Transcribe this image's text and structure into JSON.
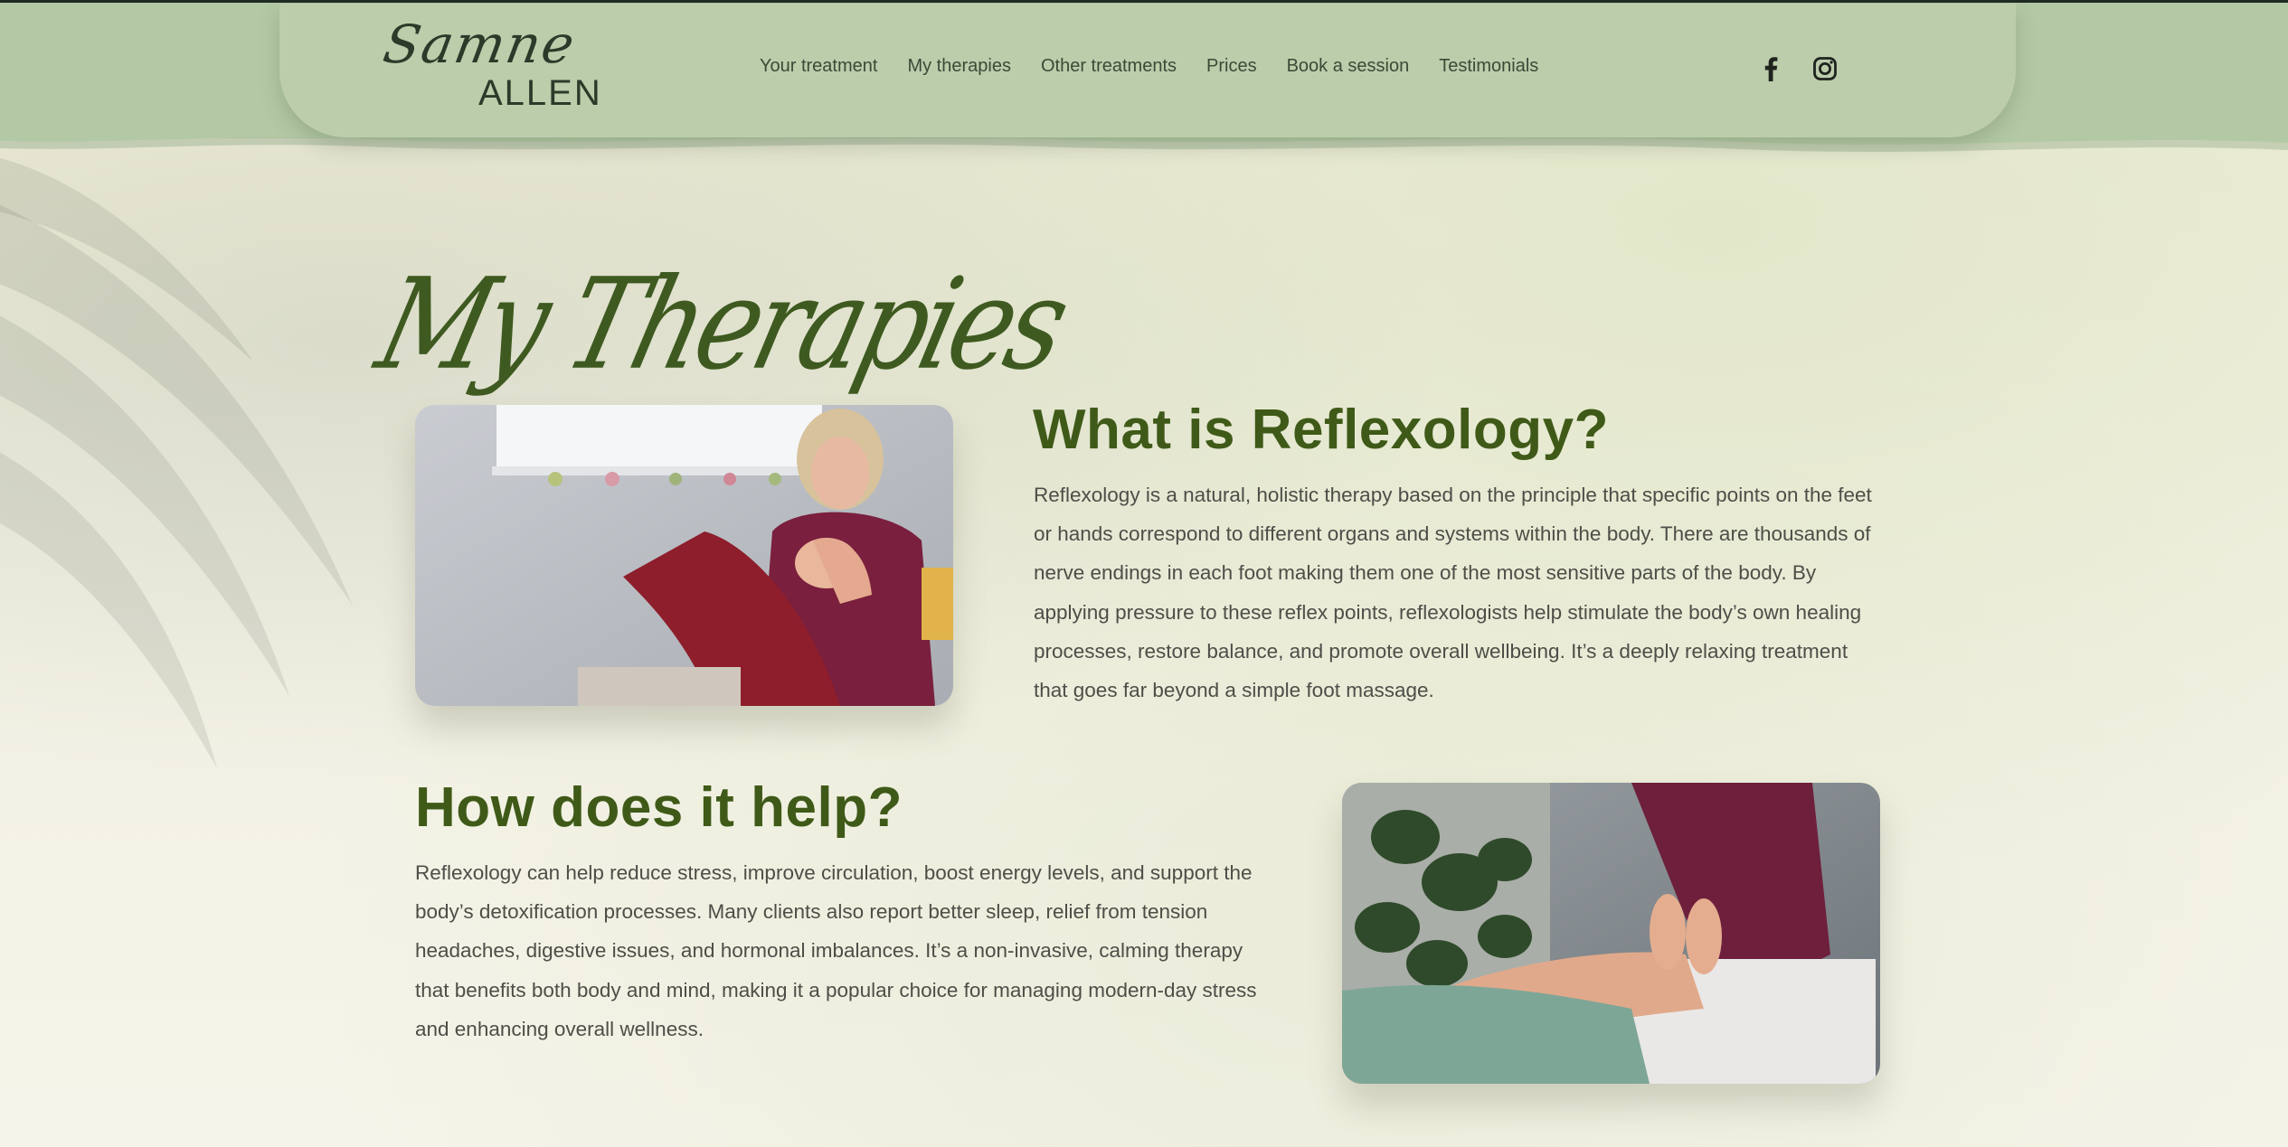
{
  "header": {
    "logo_script": "Samne",
    "logo_name": "ALLEN",
    "nav": [
      {
        "label": "Your treatment"
      },
      {
        "label": "My therapies"
      },
      {
        "label": "Other treatments"
      },
      {
        "label": "Prices"
      },
      {
        "label": "Book a session"
      },
      {
        "label": "Testimonials"
      }
    ],
    "social_icons": [
      "facebook-icon",
      "instagram-icon"
    ]
  },
  "page": {
    "heading": "My Therapies"
  },
  "sections": [
    {
      "title": "What is Reflexology?",
      "body": "Reflexology is a natural, holistic therapy based on the principle that specific points on the feet or hands correspond to different organs and systems within the body. There are thousands of nerve endings in each foot making them one of the most sensitive parts of the body. By applying pressure to these reflex points, reflexologists help stimulate the body’s own healing processes, restore balance, and promote overall wellbeing. It’s a deeply relaxing treatment that goes far beyond a simple foot massage."
    },
    {
      "title": "How does it help?",
      "body": "Reflexology can help reduce stress, improve circulation, boost energy levels, and support the body’s detoxification processes. Many clients also report better sleep, relief from tension headaches, digestive issues, and hormonal imbalances. It’s a non-invasive, calming therapy that benefits both body and mind, making it a popular choice for managing modern-day stress and enhancing overall wellness."
    }
  ],
  "colors": {
    "header_green": "#b3c8a4",
    "heading_green": "#3f5a18",
    "body_text": "#4e4e48",
    "page_bg": "#f3f1e1"
  }
}
